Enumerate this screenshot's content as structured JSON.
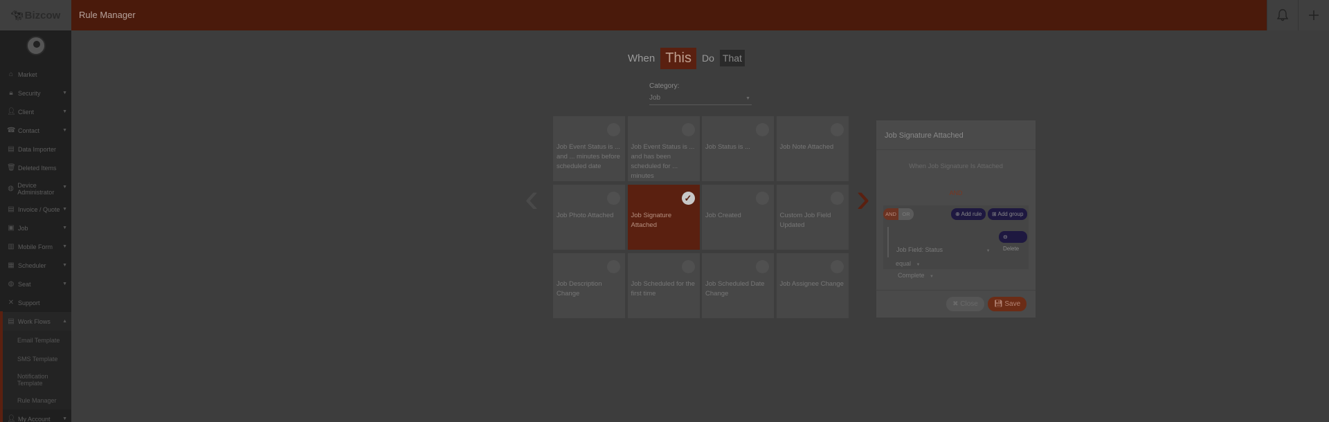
{
  "app": {
    "logo_text": "Bizcow",
    "page_title": "Rule Manager"
  },
  "topbar": {
    "bell_icon": "bell-icon",
    "add_icon": "plus-icon"
  },
  "sidebar": {
    "items": [
      {
        "label": "Market",
        "icon": "⌂",
        "caret": ""
      },
      {
        "label": "Security",
        "icon": "🔒︎",
        "caret": "▼"
      },
      {
        "label": "Client",
        "icon": "👤︎",
        "caret": "▼"
      },
      {
        "label": "Contact",
        "icon": "☎",
        "caret": "▼"
      },
      {
        "label": "Data Importer",
        "icon": "▤",
        "caret": ""
      },
      {
        "label": "Deleted Items",
        "icon": "🗑︎",
        "caret": ""
      },
      {
        "label": "Device Administrator",
        "icon": "◍",
        "caret": "▼"
      },
      {
        "label": "Invoice / Quote",
        "icon": "▤",
        "caret": "▼"
      },
      {
        "label": "Job",
        "icon": "▣",
        "caret": "▼"
      },
      {
        "label": "Mobile Form",
        "icon": "▥",
        "caret": "▼"
      },
      {
        "label": "Scheduler",
        "icon": "▦",
        "caret": "▼"
      },
      {
        "label": "Seat",
        "icon": "◍",
        "caret": "▼"
      },
      {
        "label": "Support",
        "icon": "✕",
        "caret": ""
      },
      {
        "label": "Work Flows",
        "icon": "▤",
        "caret": "▲"
      }
    ],
    "sub_items": [
      {
        "label": "Email Template"
      },
      {
        "label": "SMS Template"
      },
      {
        "label": "Notification Template"
      },
      {
        "label": "Rule Manager"
      }
    ],
    "after_item": {
      "label": "My Account",
      "icon": "👤︎",
      "caret": "▼"
    }
  },
  "builder": {
    "when": "When",
    "this": "This",
    "do": "Do",
    "that": "That",
    "category_label": "Category:",
    "category_value": "Job"
  },
  "cards": [
    {
      "label": "Job Event Status is ... and ... minutes before scheduled date"
    },
    {
      "label": "Job Event Status is ... and has been scheduled for ... minutes"
    },
    {
      "label": "Job Status is ..."
    },
    {
      "label": "Job Note Attached"
    },
    {
      "label": "Job Photo Attached"
    },
    {
      "label": "Job Signature Attached"
    },
    {
      "label": "Job Created"
    },
    {
      "label": "Custom Job Field Updated"
    },
    {
      "label": "Job Description Change"
    },
    {
      "label": "Job Scheduled for the first time"
    },
    {
      "label": "Job Scheduled Date Change"
    },
    {
      "label": "Job Assignee Change"
    }
  ],
  "modal": {
    "title": "Job Signature Attached",
    "description": "When Job Signature Is Attached",
    "and_text": "AND",
    "toggle_and": "AND",
    "toggle_or": "OR",
    "add_rule": "Add rule",
    "add_group": "Add group",
    "delete": "Delete",
    "field": "Job Field: Status",
    "operator": "equal",
    "value": "Complete",
    "close": "Close",
    "save": "Save"
  }
}
